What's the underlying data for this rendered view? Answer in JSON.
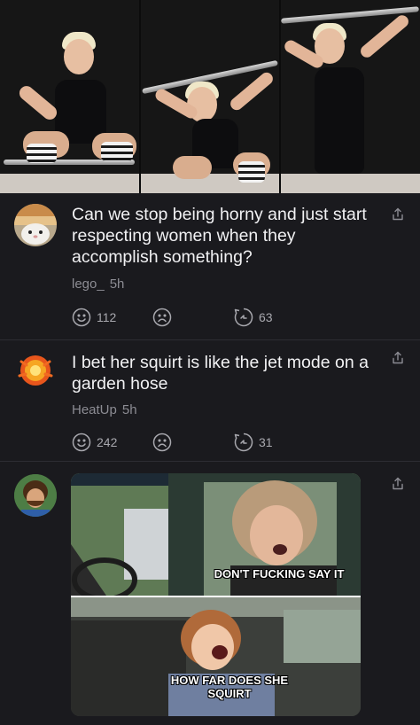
{
  "post_images": {
    "panels": [
      {
        "alt_icon": "weightlifter-photo-1"
      },
      {
        "alt_icon": "weightlifter-photo-2"
      },
      {
        "alt_icon": "weightlifter-photo-3"
      }
    ]
  },
  "comments": [
    {
      "text": "Can we stop being horny and just start respecting women when they accomplish something?",
      "username": "lego_",
      "time": "5h",
      "upvotes": "112",
      "replies": "63",
      "avatar_icon": "hamster-avatar-icon"
    },
    {
      "text": "I bet her squirt is like the jet mode on a garden hose",
      "username": "HeatUp",
      "time": "5h",
      "upvotes": "242",
      "replies": "31",
      "avatar_icon": "fireball-avatar-icon"
    },
    {
      "text": "",
      "username": "",
      "time": "",
      "avatar_icon": "bearded-man-avatar-icon",
      "meme": {
        "top_caption": "DON'T FUCKING SAY IT",
        "bottom_caption": "HOW FAR DOES SHE SQUIRT"
      }
    }
  ],
  "colors": {
    "background": "#1a1a1e",
    "text": "#f1f1f3",
    "meta": "#8c8c93",
    "divider": "#2d2d33"
  }
}
